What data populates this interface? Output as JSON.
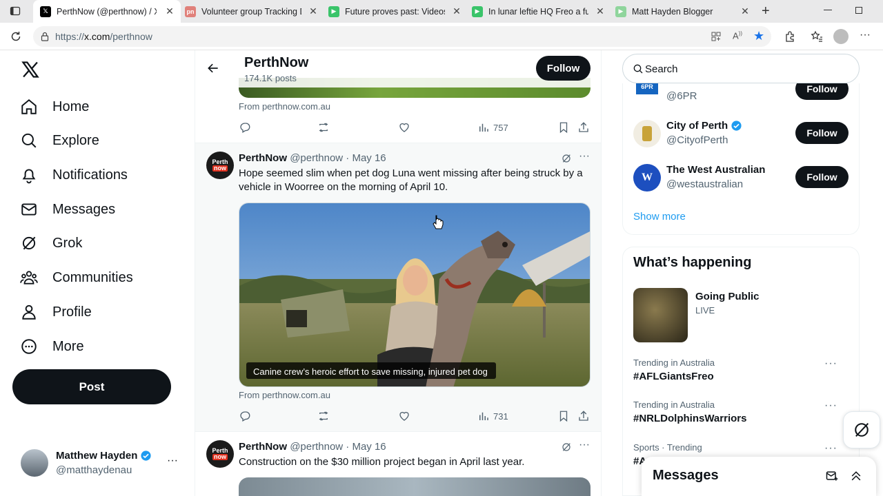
{
  "browser": {
    "tabs": [
      {
        "title": "PerthNow (@perthnow) / X",
        "favicon": "x-logo-icon",
        "active": true
      },
      {
        "title": "Volunteer group Tracking Do",
        "favicon": "pn-icon",
        "active": false
      },
      {
        "title": "Future proves past: Videos fr",
        "favicon": "play-icon",
        "active": false
      },
      {
        "title": "In lunar leftie HQ Freo a full",
        "favicon": "play-icon",
        "active": false
      },
      {
        "title": "Matt Hayden Blogger",
        "favicon": "play-icon",
        "active": false
      }
    ],
    "url_prefix": "https://",
    "url_host": "x.com",
    "url_path": "/perthnow"
  },
  "nav": {
    "items": [
      {
        "label": "Home",
        "icon": "home-icon"
      },
      {
        "label": "Explore",
        "icon": "search-icon"
      },
      {
        "label": "Notifications",
        "icon": "bell-icon"
      },
      {
        "label": "Messages",
        "icon": "mail-icon"
      },
      {
        "label": "Grok",
        "icon": "grok-icon"
      },
      {
        "label": "Communities",
        "icon": "people-icon"
      },
      {
        "label": "Profile",
        "icon": "person-icon"
      },
      {
        "label": "More",
        "icon": "more-circle-icon"
      }
    ],
    "post_label": "Post",
    "account": {
      "name": "Matthew Hayden",
      "handle": "@matthaydenau"
    }
  },
  "header": {
    "title": "PerthNow",
    "subtitle": "174.1K posts",
    "follow_label": "Follow"
  },
  "feed": {
    "top_tweet": {
      "source": "From perthnow.com.au",
      "views": "757"
    },
    "tweet1": {
      "name": "PerthNow",
      "handle": "@perthnow",
      "date": "· May 16",
      "text": "Hope seemed slim when pet dog Luna went missing after being struck by a vehicle in Woorree on the morning of April 10.",
      "card_caption": "Canine crew’s heroic effort to save missing, injured pet dog",
      "source": "From perthnow.com.au",
      "views": "731"
    },
    "tweet2": {
      "name": "PerthNow",
      "handle": "@perthnow",
      "date": "· May 16",
      "text": "Construction on the $30 million project began in April last year."
    }
  },
  "sidebar": {
    "search_placeholder": "Search",
    "who_to_follow": [
      {
        "name": "",
        "handle": "@6PR",
        "follow": "Follow"
      },
      {
        "name": "City of Perth",
        "handle": "@CityofPerth",
        "follow": "Follow"
      },
      {
        "name": "The West Australian",
        "handle": "@westaustralian",
        "follow": "Follow"
      }
    ],
    "show_more": "Show more",
    "happening_title": "What’s happening",
    "live": {
      "title": "Going Public",
      "status": "LIVE"
    },
    "trends": [
      {
        "context": "Trending in Australia",
        "tag": "#AFLGiantsFreo"
      },
      {
        "context": "Trending in Australia",
        "tag": "#NRLDolphinsWarriors"
      },
      {
        "context": "Sports · Trending",
        "tag": "#A"
      }
    ],
    "messages_title": "Messages"
  },
  "colors": {
    "accent": "#1d9bf0",
    "text": "#0f1419",
    "muted": "#536471",
    "verified": "#1d9bf0"
  }
}
